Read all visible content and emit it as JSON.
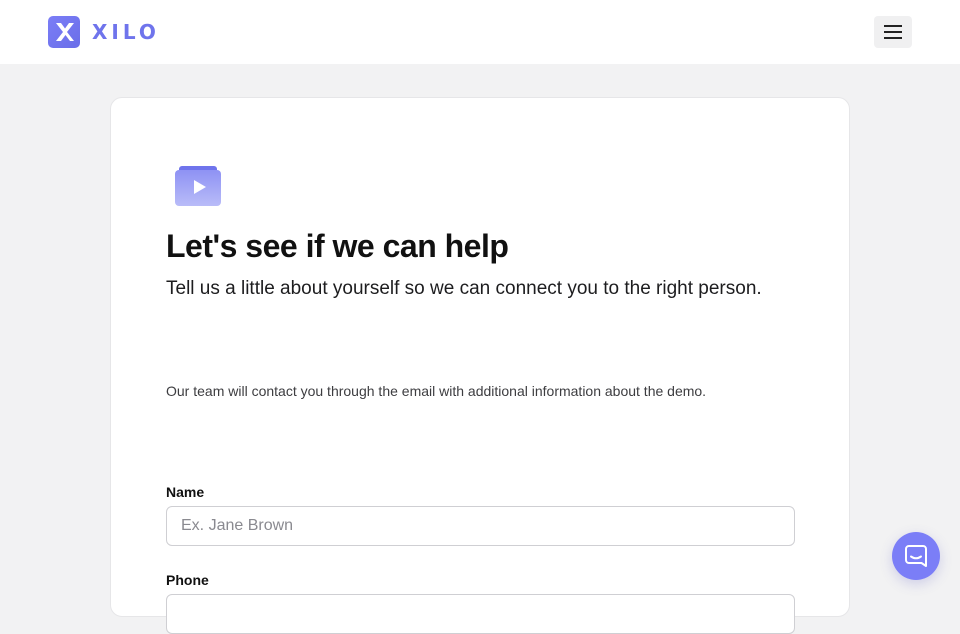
{
  "header": {
    "brand": "XILO",
    "brand_color": "#6f74ec",
    "logo_icon": "xilo-logo-icon",
    "menu_icon": "hamburger-menu-icon"
  },
  "card": {
    "hero_icon": "video-folder-icon",
    "title": "Let's see if we can help",
    "subtitle": "Tell us a little about yourself so we can connect you to the right person.",
    "note": "Our team will contact you through the email with additional information about the demo."
  },
  "form": {
    "name_label": "Name",
    "name_placeholder": "Ex. Jane Brown",
    "name_value": "",
    "phone_label": "Phone",
    "phone_value": ""
  },
  "chat": {
    "icon": "chat-icon",
    "color": "#7b7ef7"
  }
}
